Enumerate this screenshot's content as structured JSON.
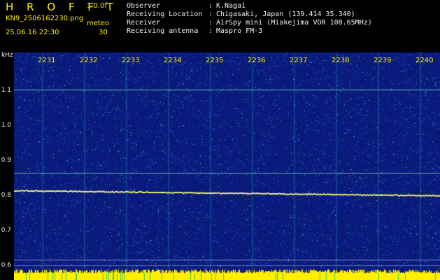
{
  "header": {
    "app_title": "H R O F F T",
    "version": "1.0.0f",
    "filename": "KN9_2506162230.png",
    "datetime": "25.06.16 22:30",
    "meteo_label": "meteo",
    "meteo_value": "30"
  },
  "info": [
    {
      "label": "Observer",
      "value": "K.Nagai"
    },
    {
      "label": "Receiving Location",
      "value": "Chigasaki, Japan (139.414 35.340)"
    },
    {
      "label": "Receiver",
      "value": "AirSpy mini (Miakejima VOR 108.65MHz)"
    },
    {
      "label": "Receiving antenna",
      "value": "Maspro FM-3"
    }
  ],
  "axis": {
    "y_unit": "kHz",
    "y_ticks": [
      "1.1",
      "1.0",
      "0.9",
      "0.8",
      "0.7",
      "0.6"
    ],
    "x_ticks": [
      "2231",
      "2232",
      "2233",
      "2234",
      "2235",
      "2236",
      "2237",
      "2238",
      "2239",
      "2240"
    ]
  },
  "colors": {
    "background": "#000000",
    "header_text": "#ffee00",
    "info_text": "#f2f2f2",
    "spectrogram_base": "#0a1a7a",
    "noise_bright": "#39d0e0",
    "signal_line": "#7fe8c8",
    "strong_signal": "#d8ff80",
    "baseline": "#ffee00"
  }
}
